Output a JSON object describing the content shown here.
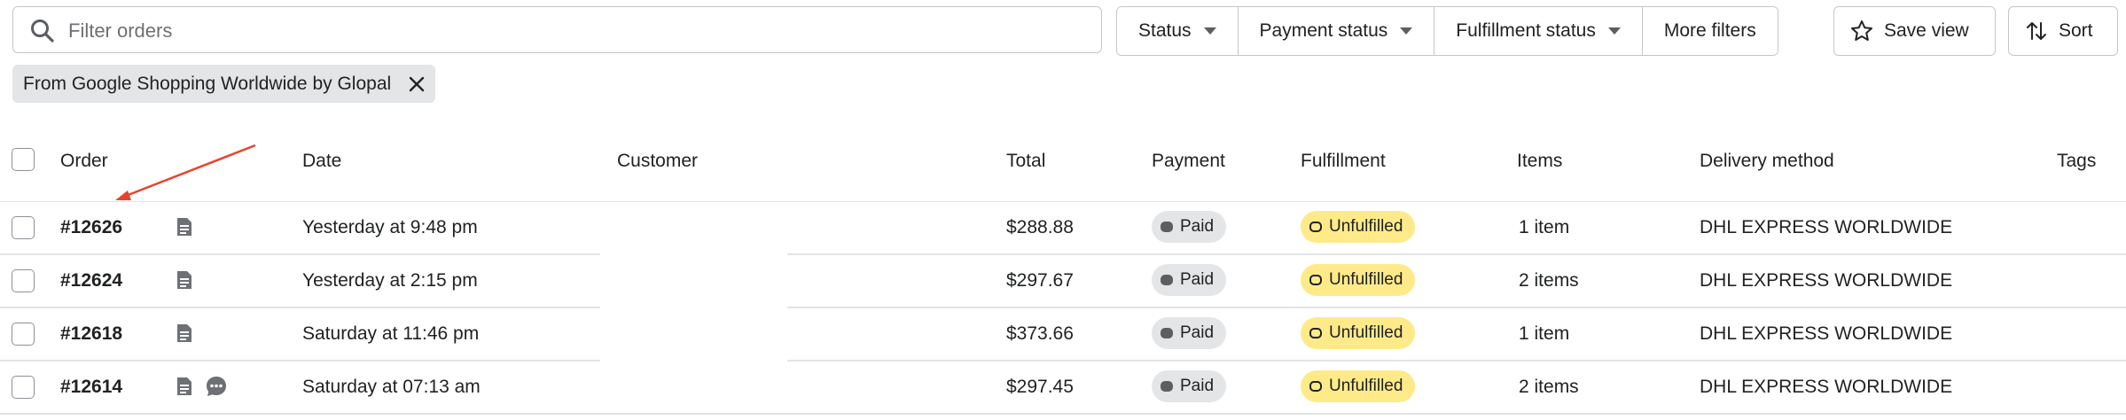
{
  "filters": {
    "search_placeholder": "Filter orders",
    "status": "Status",
    "payment_status": "Payment status",
    "fulfillment_status": "Fulfillment status",
    "more_filters": "More filters",
    "save_view": "Save view",
    "sort": "Sort"
  },
  "applied_filter": {
    "label": "From Google Shopping Worldwide by Glopal"
  },
  "columns": {
    "order": "Order",
    "date": "Date",
    "customer": "Customer",
    "total": "Total",
    "payment": "Payment",
    "fulfillment": "Fulfillment",
    "items": "Items",
    "delivery": "Delivery method",
    "tags": "Tags"
  },
  "orders": [
    {
      "id": "#12626",
      "date": "Yesterday at 9:48 pm",
      "customer": "",
      "total": "$288.88",
      "payment": "Paid",
      "fulfillment": "Unfulfilled",
      "items": "1 item",
      "delivery": "DHL EXPRESS WORLDWIDE"
    },
    {
      "id": "#12624",
      "date": "Yesterday at 2:15 pm",
      "customer": "",
      "total": "$297.67",
      "payment": "Paid",
      "fulfillment": "Unfulfilled",
      "items": "2 items",
      "delivery": "DHL EXPRESS WORLDWIDE"
    },
    {
      "id": "#12618",
      "date": "Saturday at 11:46 pm",
      "customer": "",
      "total": "$373.66",
      "payment": "Paid",
      "fulfillment": "Unfulfilled",
      "items": "1 item",
      "delivery": "DHL EXPRESS WORLDWIDE"
    },
    {
      "id": "#12614",
      "date": "Saturday at 07:13 am",
      "customer": "",
      "total": "$297.45",
      "payment": "Paid",
      "fulfillment": "Unfulfilled",
      "items": "2 items",
      "delivery": "DHL EXPRESS WORLDWIDE"
    }
  ],
  "colors": {
    "border": "#c4c7ca",
    "paid_badge": "#e4e5e7",
    "unfulfilled_badge": "#ffea8a",
    "annotation_arrow": "#e8432d"
  },
  "icons": {
    "search": "search-icon",
    "caret": "caret-down-icon",
    "star": "star-icon",
    "sort": "sort-arrows-icon",
    "close": "close-icon",
    "note": "note-icon",
    "comment": "comment-icon"
  }
}
